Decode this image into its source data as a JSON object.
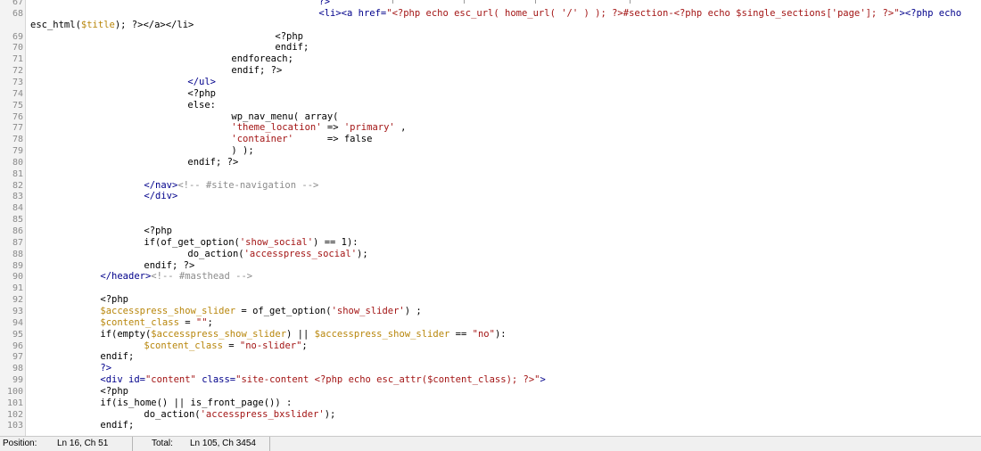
{
  "lines": [
    {
      "n": "67",
      "i": 330,
      "p": [
        [
          "?>",
          "tag"
        ]
      ]
    },
    {
      "n": "68",
      "i": 330,
      "p": [
        [
          "<li><a href=",
          "tag"
        ],
        [
          "\"<?php echo esc_url( home_url( '/' ) ); ?>#section-<?php echo $single_sections['page']; ?>\"",
          "str"
        ],
        [
          "><?php echo",
          "tag"
        ]
      ]
    },
    {
      "n": "",
      "i": 0,
      "p": [
        [
          "esc_html(",
          "kw"
        ],
        [
          "$title",
          "var"
        ],
        [
          "); ?></a></li>",
          "kw"
        ]
      ]
    },
    {
      "n": "69",
      "i": 280,
      "p": [
        [
          "<?php",
          "kw"
        ]
      ]
    },
    {
      "n": "70",
      "i": 280,
      "p": [
        [
          "endif;",
          "kw"
        ]
      ]
    },
    {
      "n": "71",
      "i": 230,
      "p": [
        [
          "endforeach;",
          "kw"
        ]
      ]
    },
    {
      "n": "72",
      "i": 230,
      "p": [
        [
          "endif; ?>",
          "kw"
        ]
      ]
    },
    {
      "n": "73",
      "i": 180,
      "p": [
        [
          "</ul>",
          "tag"
        ]
      ]
    },
    {
      "n": "74",
      "i": 180,
      "p": [
        [
          "<?php",
          "kw"
        ]
      ]
    },
    {
      "n": "75",
      "i": 180,
      "p": [
        [
          "else:",
          "kw"
        ]
      ]
    },
    {
      "n": "76",
      "i": 230,
      "p": [
        [
          "wp_nav_menu( array(",
          "kw"
        ]
      ]
    },
    {
      "n": "77",
      "i": 230,
      "p": [
        [
          "'theme_location'",
          "str"
        ],
        [
          " => ",
          "kw"
        ],
        [
          "'primary'",
          "str"
        ],
        [
          " ,",
          "kw"
        ]
      ]
    },
    {
      "n": "78",
      "i": 230,
      "p": [
        [
          "'container'",
          "str"
        ],
        [
          "      => false",
          "kw"
        ]
      ]
    },
    {
      "n": "79",
      "i": 230,
      "p": [
        [
          ") );",
          "kw"
        ]
      ]
    },
    {
      "n": "80",
      "i": 180,
      "p": [
        [
          "endif; ?>",
          "kw"
        ]
      ]
    },
    {
      "n": "81",
      "i": 0,
      "p": []
    },
    {
      "n": "82",
      "i": 130,
      "p": [
        [
          "</nav>",
          "tag"
        ],
        [
          "<!-- #site-navigation -->",
          "cmt"
        ]
      ]
    },
    {
      "n": "83",
      "i": 130,
      "p": [
        [
          "</div>",
          "tag"
        ]
      ]
    },
    {
      "n": "84",
      "i": 0,
      "p": []
    },
    {
      "n": "85",
      "i": 0,
      "p": []
    },
    {
      "n": "86",
      "i": 130,
      "p": [
        [
          "<?php",
          "kw"
        ]
      ]
    },
    {
      "n": "87",
      "i": 130,
      "p": [
        [
          "if(of_get_option(",
          "kw"
        ],
        [
          "'show_social'",
          "str"
        ],
        [
          ") == 1):",
          "kw"
        ]
      ]
    },
    {
      "n": "88",
      "i": 180,
      "p": [
        [
          "do_action(",
          "kw"
        ],
        [
          "'accesspress_social'",
          "str"
        ],
        [
          ");",
          "kw"
        ]
      ]
    },
    {
      "n": "89",
      "i": 130,
      "p": [
        [
          "endif; ?>",
          "kw"
        ]
      ]
    },
    {
      "n": "90",
      "i": 80,
      "p": [
        [
          "</header>",
          "tag"
        ],
        [
          "<!-- #masthead -->",
          "cmt"
        ]
      ]
    },
    {
      "n": "91",
      "i": 0,
      "p": []
    },
    {
      "n": "92",
      "i": 80,
      "p": [
        [
          "<?php",
          "kw"
        ]
      ]
    },
    {
      "n": "93",
      "i": 80,
      "p": [
        [
          "$accesspress_show_slider",
          "var"
        ],
        [
          " = of_get_option(",
          "kw"
        ],
        [
          "'show_slider'",
          "str"
        ],
        [
          ") ;",
          "kw"
        ]
      ]
    },
    {
      "n": "94",
      "i": 80,
      "p": [
        [
          "$content_class",
          "var"
        ],
        [
          " = ",
          "kw"
        ],
        [
          "\"\"",
          "str"
        ],
        [
          ";",
          "kw"
        ]
      ]
    },
    {
      "n": "95",
      "i": 80,
      "p": [
        [
          "if(empty(",
          "kw"
        ],
        [
          "$accesspress_show_slider",
          "var"
        ],
        [
          ") || ",
          "kw"
        ],
        [
          "$accesspress_show_slider",
          "var"
        ],
        [
          " == ",
          "kw"
        ],
        [
          "\"no\"",
          "str"
        ],
        [
          "):",
          "kw"
        ]
      ]
    },
    {
      "n": "96",
      "i": 130,
      "p": [
        [
          "$content_class",
          "var"
        ],
        [
          " = ",
          "kw"
        ],
        [
          "\"no-slider\"",
          "str"
        ],
        [
          ";",
          "kw"
        ]
      ]
    },
    {
      "n": "97",
      "i": 80,
      "p": [
        [
          "endif;",
          "kw"
        ]
      ]
    },
    {
      "n": "98",
      "i": 80,
      "p": [
        [
          "?>",
          "tag"
        ]
      ]
    },
    {
      "n": "99",
      "i": 80,
      "p": [
        [
          "<div id=",
          "tag"
        ],
        [
          "\"content\"",
          "str"
        ],
        [
          " class=",
          "tag"
        ],
        [
          "\"site-content <?php echo esc_attr($content_class); ?>\"",
          "str"
        ],
        [
          ">",
          "tag"
        ]
      ]
    },
    {
      "n": "100",
      "i": 80,
      "p": [
        [
          "<?php",
          "kw"
        ]
      ]
    },
    {
      "n": "101",
      "i": 80,
      "p": [
        [
          "if(is_home() || is_front_page()) :",
          "kw"
        ]
      ]
    },
    {
      "n": "102",
      "i": 130,
      "p": [
        [
          "do_action(",
          "kw"
        ],
        [
          "'accesspress_bxslider'",
          "str"
        ],
        [
          ");",
          "kw"
        ]
      ]
    },
    {
      "n": "103",
      "i": 80,
      "p": [
        [
          "endif;",
          "kw"
        ]
      ]
    }
  ],
  "statusbar": {
    "position_label": "Position:",
    "position_value": "Ln 16, Ch 51",
    "total_label": "Total:",
    "total_value": "Ln 105, Ch 3454"
  }
}
